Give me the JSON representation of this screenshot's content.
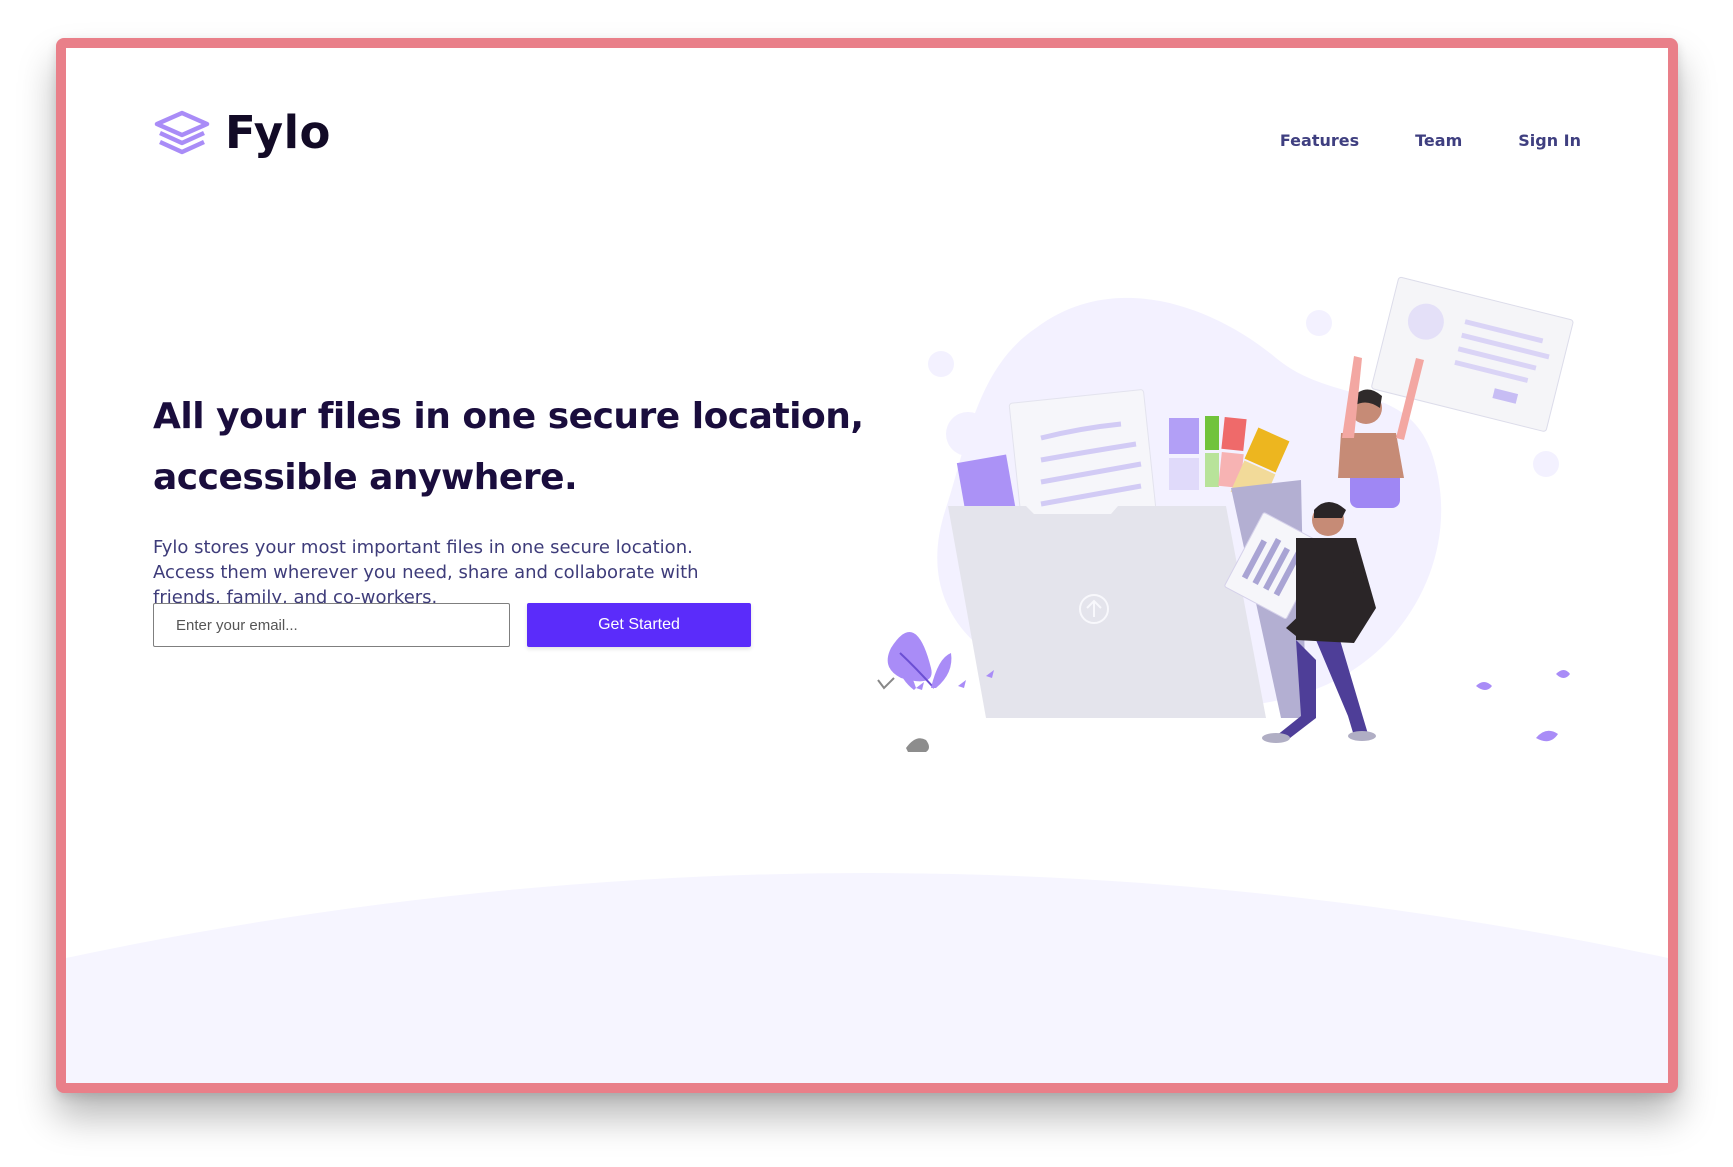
{
  "brand": {
    "name": "Fylo",
    "logo_icon": "stacked-layers-icon",
    "accent_color": "#5b2cfa",
    "logo_color": "#a98cf7"
  },
  "nav": {
    "items": [
      {
        "label": "Features"
      },
      {
        "label": "Team"
      },
      {
        "label": "Sign In"
      }
    ]
  },
  "hero": {
    "headline": "All your files in one secure location, accessible anywhere.",
    "description": "Fylo stores your most important files in one secure location. Access them wherever you need, share and collaborate with friends, family, and co-workers.",
    "email_placeholder": "Enter your email...",
    "cta_label": "Get Started",
    "illustration_icon": "file-sharing-illustration",
    "upload_icon": "upload-arrow-icon"
  },
  "colors": {
    "frame_border": "#e97f89",
    "headline": "#1a0d3d",
    "body_text": "#3e3c7a",
    "nav_text": "#3f3f80",
    "curve_background": "#f6f5ff"
  }
}
